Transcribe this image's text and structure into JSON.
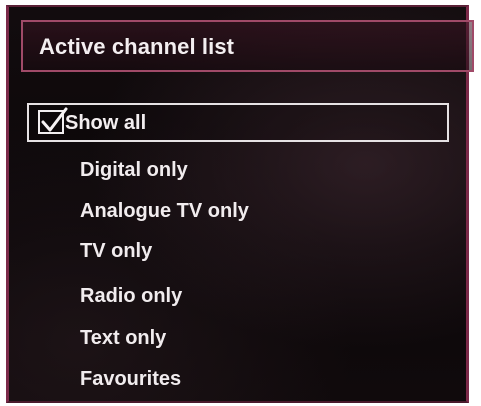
{
  "menu": {
    "title": "Active channel list",
    "selected": {
      "label": "Show all",
      "checked": true
    },
    "options": [
      "Digital only",
      "Analogue TV only",
      "TV only",
      "Radio only",
      "Text only",
      "Favourites"
    ]
  },
  "colors": {
    "frame_accent": "#7b2a49",
    "header_border": "#a04a68",
    "text": "#f3eef0"
  }
}
